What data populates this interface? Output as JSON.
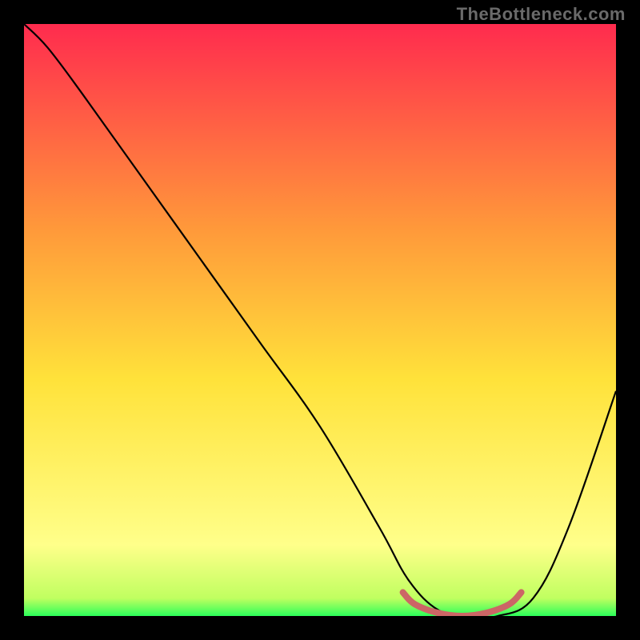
{
  "watermark": "TheBottleneck.com",
  "colors": {
    "black": "#000000",
    "curve": "#000000",
    "marker": "#cc6666",
    "grad_top": "#ff2b4e",
    "grad_mid_upper": "#ff9a3a",
    "grad_mid": "#ffe23a",
    "grad_lower": "#ffff8a",
    "grad_bottom": "#2bff5a"
  },
  "chart_data": {
    "type": "line",
    "title": "",
    "xlabel": "",
    "ylabel": "",
    "xlim": [
      0,
      100
    ],
    "ylim": [
      0,
      100
    ],
    "series": [
      {
        "name": "bottleneck-curve",
        "x": [
          0,
          4,
          10,
          20,
          30,
          40,
          50,
          60,
          65,
          70,
          75,
          80,
          86,
          92,
          100
        ],
        "values": [
          100,
          96,
          88,
          74,
          60,
          46,
          32,
          15,
          6,
          1,
          0,
          0,
          3,
          15,
          38
        ]
      }
    ],
    "marker_band": {
      "name": "sweet-spot",
      "x": [
        64,
        66,
        70,
        74,
        78,
        82,
        84
      ],
      "values": [
        4,
        2,
        0.5,
        0,
        0.5,
        2,
        4
      ]
    },
    "gradient_stops": [
      {
        "offset": 0.0,
        "color": "#ff2b4e"
      },
      {
        "offset": 0.35,
        "color": "#ff9a3a"
      },
      {
        "offset": 0.6,
        "color": "#ffe23a"
      },
      {
        "offset": 0.88,
        "color": "#ffff8a"
      },
      {
        "offset": 0.97,
        "color": "#c0ff60"
      },
      {
        "offset": 1.0,
        "color": "#2bff5a"
      }
    ]
  }
}
